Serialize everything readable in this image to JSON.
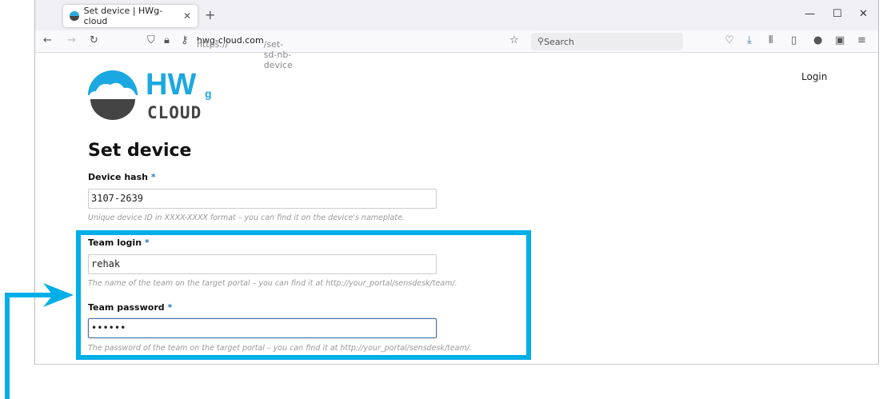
{
  "browser": {
    "tab_title": "Set device | HWg-cloud",
    "url_prefix": "https://",
    "url_domain": "hwg-cloud.com",
    "url_path": "/set-sd-nb-device",
    "search_placeholder": "Search"
  },
  "header": {
    "login": "Login",
    "logo_text": "HWg",
    "logo_sub": "CLOUD"
  },
  "form": {
    "title": "Set device",
    "device_hash": {
      "label": "Device hash",
      "required": "*",
      "value": "3107-2639",
      "hint": "Unique device ID in XXXX-XXXX format – you can find it on the device's nameplate."
    },
    "team_login": {
      "label": "Team login",
      "required": "*",
      "value": "rehak",
      "hint": "The name of the team on the target portal – you can find it at http://your_portal/sensdesk/team/."
    },
    "team_password": {
      "label": "Team password",
      "required": "*",
      "value": "••••••",
      "hint": "The password of the team on the target portal – you can find it at http://your_portal/sensdesk/team/."
    }
  },
  "colors": {
    "accent": "#00aee8"
  }
}
